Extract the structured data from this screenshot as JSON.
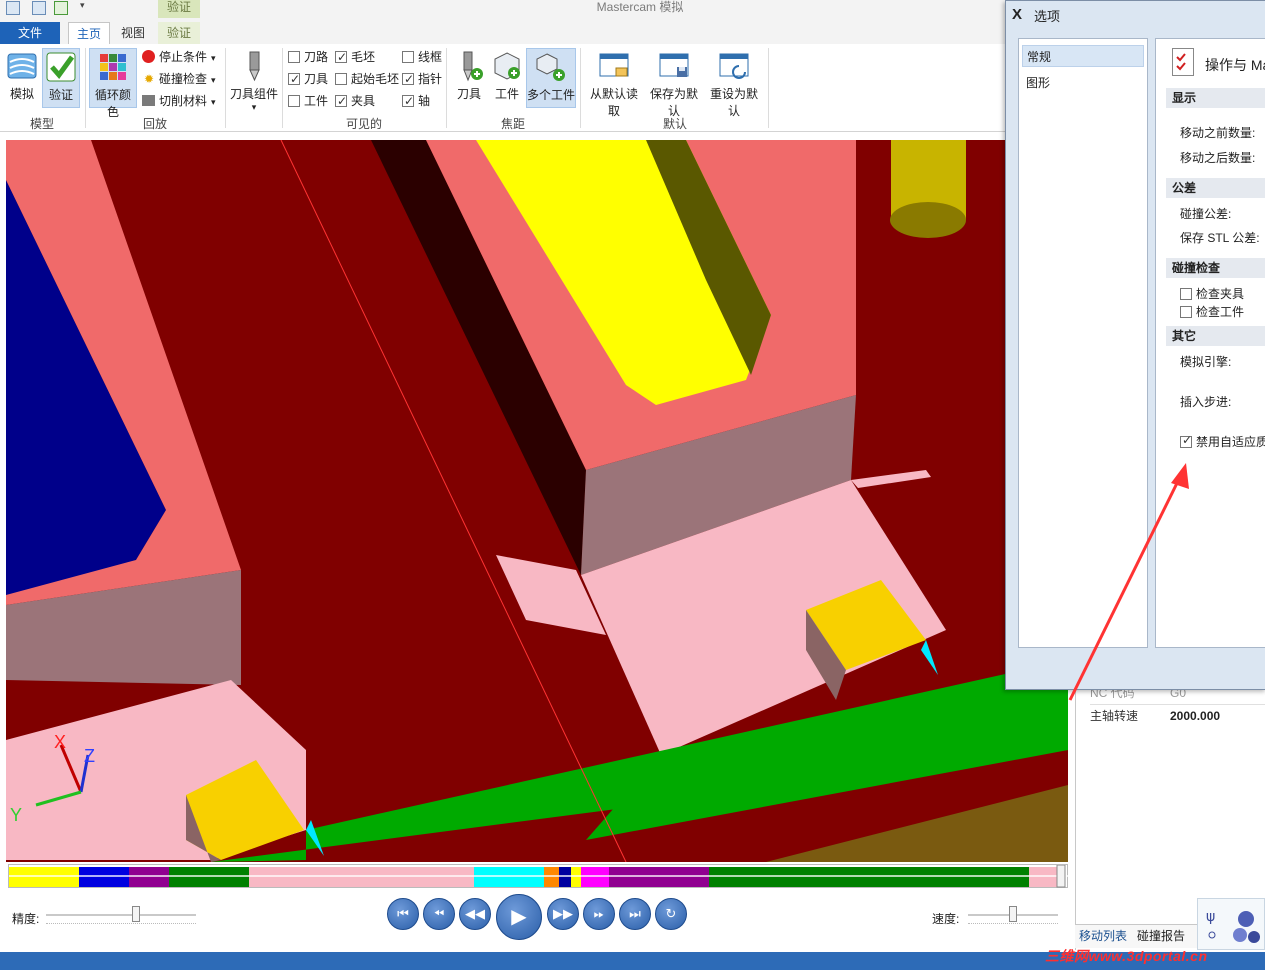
{
  "app": {
    "title": "Mastercam 模拟",
    "context_tab": "验证"
  },
  "tabs": {
    "file": "文件",
    "home": "主页",
    "view": "视图",
    "verify": "验证"
  },
  "ribbon": {
    "model": {
      "label": "模型",
      "simulate": "模拟",
      "verify": "验证"
    },
    "playback": {
      "label": "回放",
      "cycle_colors": "循环颜色",
      "stop_conditions": "停止条件",
      "collision_check": "碰撞检查",
      "cut_material": "切削材料"
    },
    "tool_assembly": "刀具组件",
    "visible": {
      "label": "可见的",
      "items": [
        {
          "label": "刀路",
          "checked": false
        },
        {
          "label": "毛坯",
          "checked": true
        },
        {
          "label": "线框",
          "checked": false
        },
        {
          "label": "刀具",
          "checked": true
        },
        {
          "label": "起始毛坯",
          "checked": false
        },
        {
          "label": "指针",
          "checked": true
        },
        {
          "label": "工件",
          "checked": false
        },
        {
          "label": "夹具",
          "checked": true
        },
        {
          "label": "轴",
          "checked": true
        }
      ]
    },
    "focus": {
      "label": "焦距",
      "tool": "刀具",
      "workpiece": "工件",
      "multi_workpiece": "多个工件"
    },
    "defaults": {
      "label": "默认",
      "read": "从默认读取",
      "save": "保存为默认",
      "reset": "重设为默认"
    }
  },
  "axis": {
    "x": "X",
    "y": "Y",
    "z": "Z"
  },
  "playback": {
    "precision_label": "精度:",
    "speed_label": "速度:",
    "precision_level": 0.6,
    "speed_level": 0.5
  },
  "right_panel": {
    "rows": [
      {
        "label": "NC 代码",
        "value": "G0"
      },
      {
        "label": "主轴转速",
        "value": "2000.000"
      }
    ],
    "tabs": [
      "移动列表",
      "碰撞报告"
    ]
  },
  "dialog": {
    "title": "选项",
    "nav": [
      "常规",
      "图形"
    ],
    "heading": "操作与 Ma",
    "sections": {
      "display": "显示",
      "tolerance": "公差",
      "collision": "碰撞检查",
      "other": "其它"
    },
    "fields": {
      "before_count": "移动之前数量:",
      "after_count": "移动之后数量:",
      "collision_tol": "碰撞公差:",
      "stl_tol": "保存 STL 公差:",
      "sim_engine": "模拟引擎:",
      "insert_step": "插入步进:"
    },
    "checks": [
      {
        "label": "检查夹具",
        "checked": false
      },
      {
        "label": "检查工件",
        "checked": false
      },
      {
        "label": "禁用自适应质",
        "checked": true
      }
    ]
  },
  "watermark": "三维网www.3dportal.cn",
  "colors": {
    "accent": "#1e63b8",
    "stock": "#800000",
    "highlight": "#ff3333"
  }
}
